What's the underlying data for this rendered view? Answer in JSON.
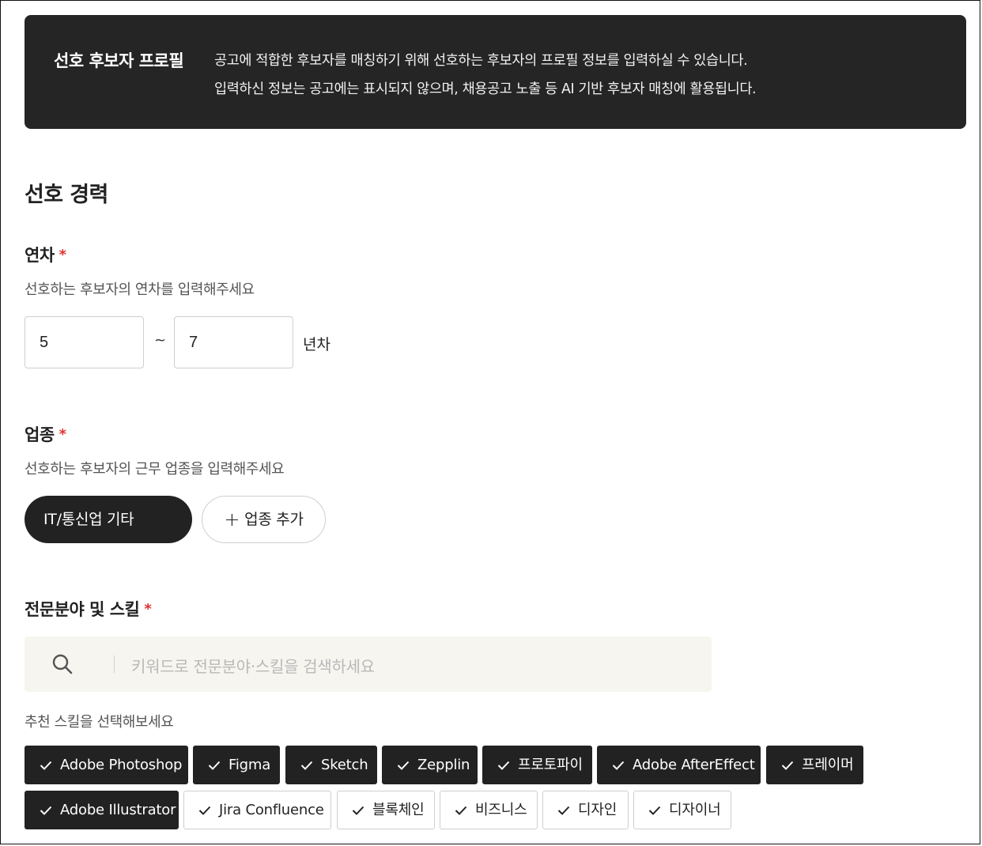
{
  "banner": {
    "title": "선호 후보자 프로필",
    "line1": "공고에 적합한 후보자를 매칭하기 위해 선호하는 후보자의 프로필 정보를 입력하실 수 있습니다.",
    "line2": "입력하신 정보는 공고에는 표시되지 않으며, 채용공고 노출 등 AI 기반 후보자 매칭에 활용됩니다."
  },
  "section_title": "선호 경력",
  "experience": {
    "label": "연차",
    "required_mark": "*",
    "help": "선호하는 후보자의 연차를 입력해주세요",
    "min_value": "5",
    "separator": "~",
    "max_value": "7",
    "unit": "년차"
  },
  "industry": {
    "label": "업종",
    "required_mark": "*",
    "help": "선호하는 후보자의 근무 업종을 입력해주세요",
    "selected": "IT/통신업 기타",
    "add_plus": "+",
    "add_label": "업종 추가"
  },
  "skills": {
    "label": "전문분야 및 스킬",
    "required_mark": "*",
    "search_placeholder": "키워드로 전문분야·스킬을 검색하세요",
    "recommend_label": "추천 스킬을 선택해보세요",
    "chips": [
      {
        "label": "Adobe Photoshop",
        "selected": true
      },
      {
        "label": "Figma",
        "selected": true
      },
      {
        "label": "Sketch",
        "selected": true
      },
      {
        "label": "Zepplin",
        "selected": true
      },
      {
        "label": "프로토파이",
        "selected": true
      },
      {
        "label": "Adobe AfterEffect",
        "selected": true
      },
      {
        "label": "프레이머",
        "selected": true
      },
      {
        "label": "Adobe Illustrator",
        "selected": true
      },
      {
        "label": "Jira Confluence",
        "selected": false
      },
      {
        "label": "블록체인",
        "selected": false
      },
      {
        "label": "비즈니스",
        "selected": false
      },
      {
        "label": "디자인",
        "selected": false
      },
      {
        "label": "디자이너",
        "selected": false
      }
    ]
  },
  "colors": {
    "dark": "#222222",
    "required": "#e03131",
    "search_bg": "#f6f5f0"
  }
}
